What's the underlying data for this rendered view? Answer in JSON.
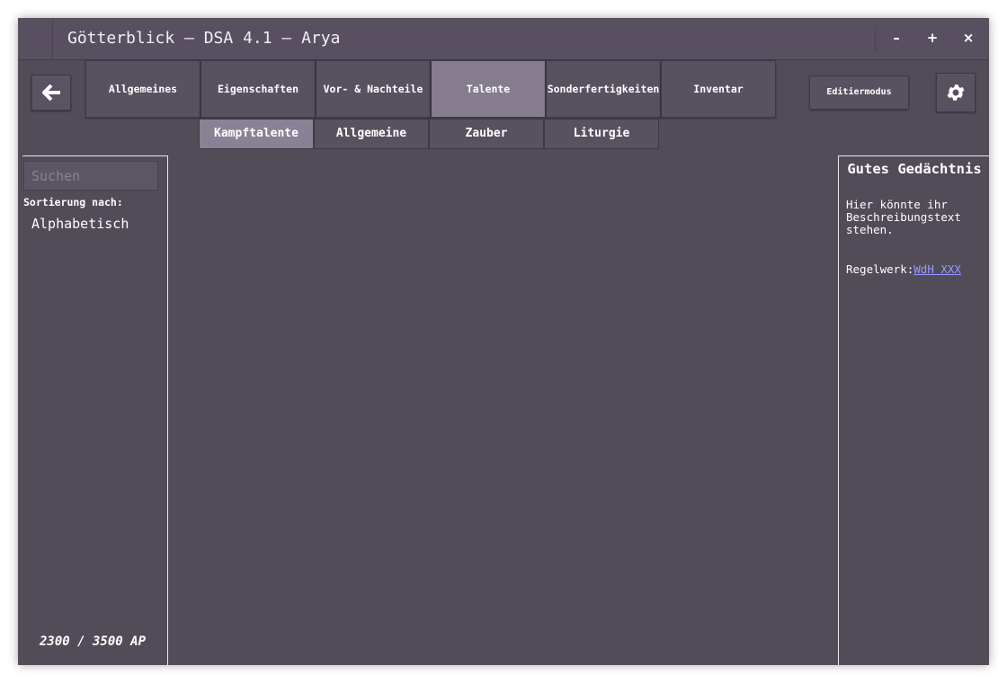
{
  "window": {
    "title": "Götterblick – DSA 4.1 – Arya",
    "controls": {
      "minimize": "–",
      "maximize": "+",
      "close": "×"
    }
  },
  "nav": {
    "back_icon": "arrow-left-icon",
    "tabs": [
      {
        "label": "Allgemeines",
        "active": false
      },
      {
        "label": "Eigenschaften",
        "active": false
      },
      {
        "label": "Vor- & Nachteile",
        "active": false
      },
      {
        "label": "Talente",
        "active": true
      },
      {
        "label": "Sonderfertigkeiten",
        "active": false
      },
      {
        "label": "Inventar",
        "active": false
      }
    ],
    "subtabs": [
      {
        "label": "Kampftalente",
        "active": true
      },
      {
        "label": "Allgemeine",
        "active": false
      },
      {
        "label": "Zauber",
        "active": false
      },
      {
        "label": "Liturgie",
        "active": false
      }
    ],
    "edit_mode_label": "Editiermodus",
    "settings_icon": "gear-icon"
  },
  "sidebar": {
    "search": {
      "placeholder": "Suchen",
      "value": ""
    },
    "sort_label": "Sortierung nach:",
    "sort_value": "Alphabetisch",
    "ap_text": "2300 / 3500 AP"
  },
  "detail": {
    "title": "Gutes Gedächtnis",
    "description": "Hier könnte ihr Beschreibungstext stehen.",
    "ruleset_label": "Regelwerk:",
    "ruleset_link": "WdH XXX"
  },
  "colors": {
    "background": "#524c58",
    "titlebar": "#585061",
    "tab": "#58515f",
    "tab_active": "#857c8e",
    "subtab_active": "#8a8194",
    "link": "#9999ff"
  }
}
